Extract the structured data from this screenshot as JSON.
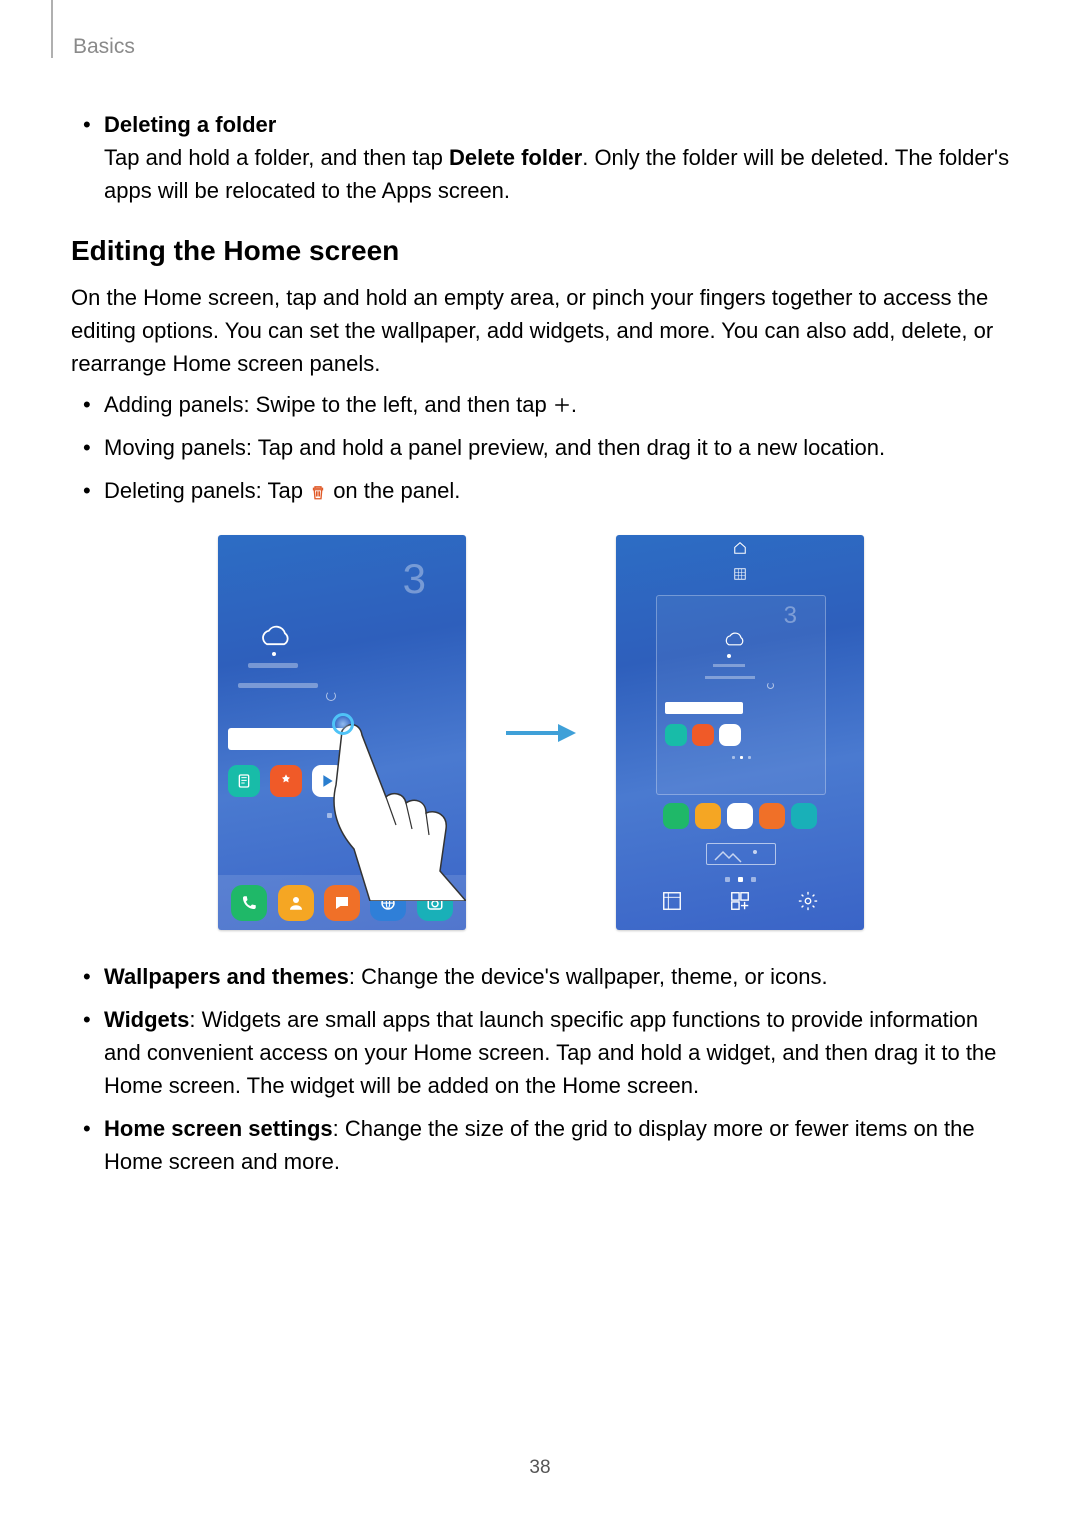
{
  "header": {
    "section": "Basics"
  },
  "page_number": "38",
  "block1": {
    "title": "Deleting a folder",
    "text_before": "Tap and hold a folder, and then tap ",
    "bold": "Delete folder",
    "text_after": ". Only the folder will be deleted. The folder's apps will be relocated to the Apps screen."
  },
  "section_title": "Editing the Home screen",
  "intro": "On the Home screen, tap and hold an empty area, or pinch your fingers together to access the editing options. You can set the wallpaper, add widgets, and more. You can also add, delete, or rearrange Home screen panels.",
  "list1": {
    "item1_a": "Adding panels: Swipe to the left, and then tap ",
    "item1_b": ".",
    "item2": "Moving panels: Tap and hold a panel preview, and then drag it to a new location.",
    "item3_a": "Deleting panels: Tap ",
    "item3_b": " on the panel."
  },
  "list2": {
    "item1_bold": "Wallpapers and themes",
    "item1_rest": ": Change the device's wallpaper, theme, or icons.",
    "item2_bold": "Widgets",
    "item2_rest": ": Widgets are small apps that launch specific app functions to provide information and convenient access on your Home screen. Tap and hold a widget, and then drag it to the Home screen. The widget will be added on the Home screen.",
    "item3_bold": "Home screen settings",
    "item3_rest": ": Change the size of the grid to display more or fewer items on the Home screen and more."
  },
  "figure": {
    "temp": "3"
  }
}
